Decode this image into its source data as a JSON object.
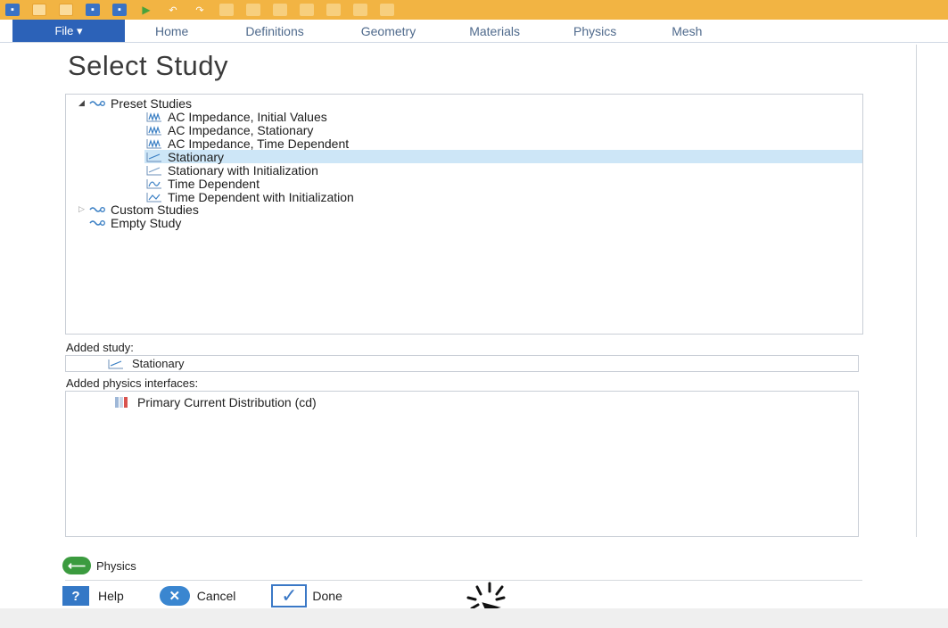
{
  "ribbon": {
    "file_label": "File ▾",
    "tabs": [
      "Home",
      "Definitions",
      "Geometry",
      "Materials",
      "Physics",
      "Mesh"
    ]
  },
  "dialog": {
    "title": "Select Study",
    "tree": {
      "preset_group": "Preset Studies",
      "preset_items": [
        "AC Impedance, Initial Values",
        "AC Impedance, Stationary",
        "AC Impedance, Time Dependent",
        "Stationary",
        "Stationary with Initialization",
        "Time Dependent",
        "Time Dependent with Initialization"
      ],
      "selected_item": "Stationary",
      "custom_group": "Custom Studies",
      "empty_item": "Empty Study"
    },
    "added_study_label": "Added study:",
    "added_study_value": "Stationary",
    "added_physics_label": "Added physics interfaces:",
    "added_physics_value": "Primary Current Distribution (cd)",
    "back_button_label": "Physics",
    "help_label": "Help",
    "cancel_label": "Cancel",
    "done_label": "Done"
  },
  "colors": {
    "quick_access_bar": "#f2b443",
    "file_tab": "#2c62b8",
    "selection": "#cde6f7",
    "back_button": "#3b9b3f"
  }
}
